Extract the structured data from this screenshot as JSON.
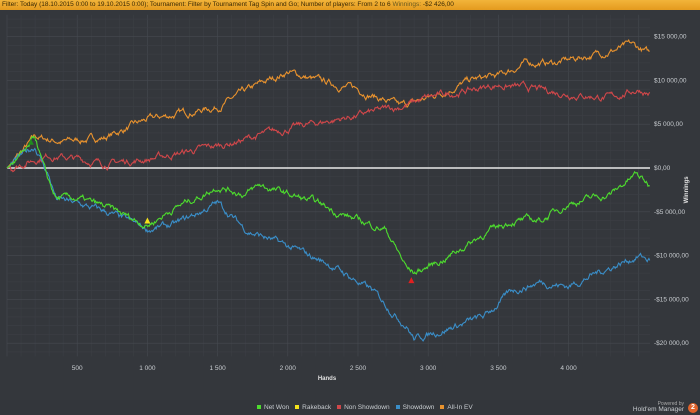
{
  "filter": {
    "text": "Filter: Today (18.10.2015 0:00 to 19.10.2015 0:00);  Tournament: Filter by Tournament Tag  Spin and Go; Number of players: From 2 to 6 ",
    "winnings_label": "Winnings: ",
    "winnings_value": "-$2 426,00"
  },
  "branding": {
    "powered_by": "Powered by",
    "name": "Hold'em Manager",
    "logo_text": "2"
  },
  "chart_data": {
    "type": "line",
    "title": "",
    "xlabel": "Hands",
    "ylabel": "Winnings",
    "xlim": [
      0,
      4580
    ],
    "ylim": [
      -21500,
      17500
    ],
    "grid": true,
    "legend_position": "bottom",
    "x_ticks": [
      500,
      1000,
      1500,
      2000,
      2500,
      3000,
      3500,
      4000
    ],
    "x_tick_labels": [
      "500",
      "1 000",
      "1 500",
      "2 000",
      "2 500",
      "3 000",
      "3 500",
      "4 000"
    ],
    "y_ticks": [
      15000,
      10000,
      5000,
      0,
      -5000,
      -10000,
      -15000,
      -20000
    ],
    "y_tick_labels": [
      "$15 000,00",
      "$10 000,00",
      "$5 000,00",
      "$0,00",
      "-$5 000,00",
      "-$10 000,00",
      "-$15 000,00",
      "-$20 000,00"
    ],
    "series": [
      {
        "name": "All-In EV",
        "color": "#e8922e",
        "points": [
          [
            0,
            0
          ],
          [
            200,
            3500
          ],
          [
            400,
            3000
          ],
          [
            700,
            3500
          ],
          [
            1000,
            5500
          ],
          [
            1500,
            7000
          ],
          [
            1800,
            9500
          ],
          [
            2000,
            11000
          ],
          [
            2200,
            10000
          ],
          [
            2500,
            9000
          ],
          [
            2800,
            7000
          ],
          [
            3000,
            8000
          ],
          [
            3300,
            10000
          ],
          [
            3500,
            10500
          ],
          [
            3700,
            12000
          ],
          [
            3900,
            12000
          ],
          [
            4200,
            13000
          ],
          [
            4450,
            14000
          ],
          [
            4580,
            13000
          ]
        ]
      },
      {
        "name": "Non Showdown",
        "color": "#d0474a",
        "points": [
          [
            0,
            0
          ],
          [
            300,
            1500
          ],
          [
            700,
            500
          ],
          [
            1000,
            1000
          ],
          [
            1500,
            2500
          ],
          [
            2000,
            4500
          ],
          [
            2500,
            6000
          ],
          [
            2800,
            7000
          ],
          [
            3000,
            8000
          ],
          [
            3500,
            9500
          ],
          [
            4000,
            8500
          ],
          [
            4300,
            8000
          ],
          [
            4500,
            9000
          ],
          [
            4580,
            8500
          ]
        ]
      },
      {
        "name": "Showdown",
        "color": "#3a8ec8",
        "points": [
          [
            0,
            0
          ],
          [
            200,
            2500
          ],
          [
            300,
            -1000
          ],
          [
            350,
            -3500
          ],
          [
            700,
            -5000
          ],
          [
            1000,
            -7000
          ],
          [
            1200,
            -6500
          ],
          [
            1500,
            -4000
          ],
          [
            1700,
            -7000
          ],
          [
            2000,
            -9000
          ],
          [
            2300,
            -11000
          ],
          [
            2600,
            -14000
          ],
          [
            2850,
            -18000
          ],
          [
            2900,
            -19500
          ],
          [
            3100,
            -18500
          ],
          [
            3400,
            -17000
          ],
          [
            3600,
            -14000
          ],
          [
            3800,
            -13000
          ],
          [
            4000,
            -13500
          ],
          [
            4200,
            -12000
          ],
          [
            4500,
            -10000
          ],
          [
            4580,
            -10500
          ]
        ]
      },
      {
        "name": "Net Won",
        "color": "#4ddc2e",
        "points": [
          [
            0,
            0
          ],
          [
            150,
            2000
          ],
          [
            200,
            3500
          ],
          [
            280,
            -1000
          ],
          [
            350,
            -3500
          ],
          [
            500,
            -3500
          ],
          [
            700,
            -4500
          ],
          [
            1000,
            -6500
          ],
          [
            1200,
            -4500
          ],
          [
            1400,
            -3000
          ],
          [
            1500,
            -2000
          ],
          [
            1700,
            -3000
          ],
          [
            1800,
            -2000
          ],
          [
            2000,
            -3000
          ],
          [
            2200,
            -4000
          ],
          [
            2500,
            -6000
          ],
          [
            2700,
            -7000
          ],
          [
            2850,
            -11500
          ],
          [
            2900,
            -12000
          ],
          [
            3100,
            -10500
          ],
          [
            3400,
            -7500
          ],
          [
            3600,
            -6000
          ],
          [
            3800,
            -6000
          ],
          [
            4000,
            -4000
          ],
          [
            4300,
            -3000
          ],
          [
            4480,
            -700
          ],
          [
            4580,
            -2000
          ]
        ]
      },
      {
        "name": "Rakeback",
        "color": "#f4e21a",
        "points": []
      }
    ],
    "markers": [
      {
        "name": "peak",
        "x": 170,
        "y": 3000,
        "color": "#1f8a1f"
      },
      {
        "name": "rakeback",
        "x": 1000,
        "y": -6000,
        "color": "#f4e21a"
      },
      {
        "name": "low",
        "x": 2880,
        "y": -12800,
        "color": "#e02020"
      }
    ],
    "legend": [
      "Net Won",
      "Rakeback",
      "Non Showdown",
      "Showdown",
      "All-In EV"
    ],
    "legend_colors": [
      "#4ddc2e",
      "#f4e21a",
      "#d0474a",
      "#3a8ec8",
      "#e8922e"
    ]
  }
}
